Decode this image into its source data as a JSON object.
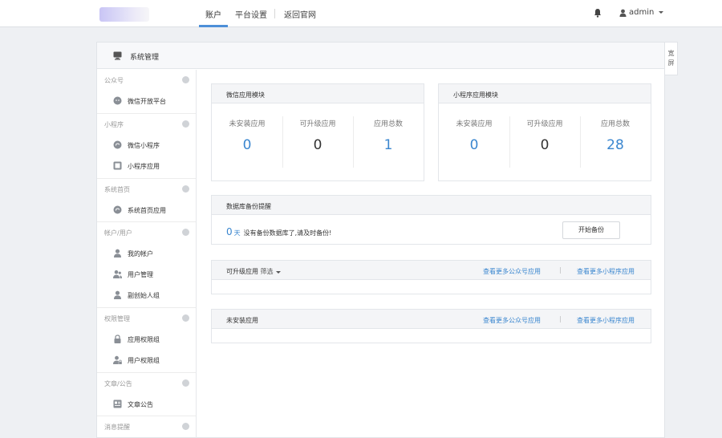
{
  "topbar": {
    "nav": [
      "账户",
      "平台设置",
      "返回官网"
    ],
    "user": "admin",
    "icons": {
      "bell": "bell-icon",
      "user": "user-icon"
    }
  },
  "panel": {
    "title": "系统管理",
    "wide_toggle": [
      "宽",
      "屏"
    ]
  },
  "sidebar": {
    "sections": [
      {
        "title": "公众号",
        "items": [
          {
            "label": "微信开放平台",
            "icon": "wechat-icon"
          }
        ]
      },
      {
        "title": "小程序",
        "items": [
          {
            "label": "微信小程序",
            "icon": "miniprogram-icon"
          },
          {
            "label": "小程序应用",
            "icon": "app-icon"
          }
        ]
      },
      {
        "title": "系统首页",
        "items": [
          {
            "label": "系统首页应用",
            "icon": "miniprogram-icon"
          }
        ]
      },
      {
        "title": "帐户/用户",
        "items": [
          {
            "label": "我的帐户",
            "icon": "user-icon"
          },
          {
            "label": "用户管理",
            "icon": "users-icon"
          },
          {
            "label": "副创始人组",
            "icon": "user-icon"
          }
        ]
      },
      {
        "title": "权限管理",
        "items": [
          {
            "label": "应用权限组",
            "icon": "lock-icon"
          },
          {
            "label": "用户权限组",
            "icon": "user-lock-icon"
          }
        ]
      },
      {
        "title": "文章/公告",
        "items": [
          {
            "label": "文章公告",
            "icon": "article-icon"
          }
        ]
      },
      {
        "title": "消息提醒",
        "items": []
      }
    ]
  },
  "wechat_card": {
    "title": "微信应用模块",
    "stats": [
      {
        "label": "未安装应用",
        "value": "0"
      },
      {
        "label": "可升级应用",
        "value": "0"
      },
      {
        "label": "应用总数",
        "value": "1"
      }
    ]
  },
  "mini_card": {
    "title": "小程序应用模块",
    "stats": [
      {
        "label": "未安装应用",
        "value": "0"
      },
      {
        "label": "可升级应用",
        "value": "0"
      },
      {
        "label": "应用总数",
        "value": "28"
      }
    ]
  },
  "backup": {
    "title": "数据库备份提醒",
    "days": "0",
    "unit": "天",
    "message": "没有备份数据库了,请及时备份!",
    "button": "开始备份"
  },
  "upgradable": {
    "title": "可升级应用",
    "filter": "筛选",
    "link_official": "查看更多公众号应用",
    "separator": "|",
    "link_mini": "查看更多小程序应用"
  },
  "uninstalled": {
    "title": "未安装应用",
    "link_official": "查看更多公众号应用",
    "separator": "|",
    "link_mini": "查看更多小程序应用"
  },
  "colors": {
    "accent": "#3a86cf",
    "nav_underline": "#4d8fd8"
  }
}
